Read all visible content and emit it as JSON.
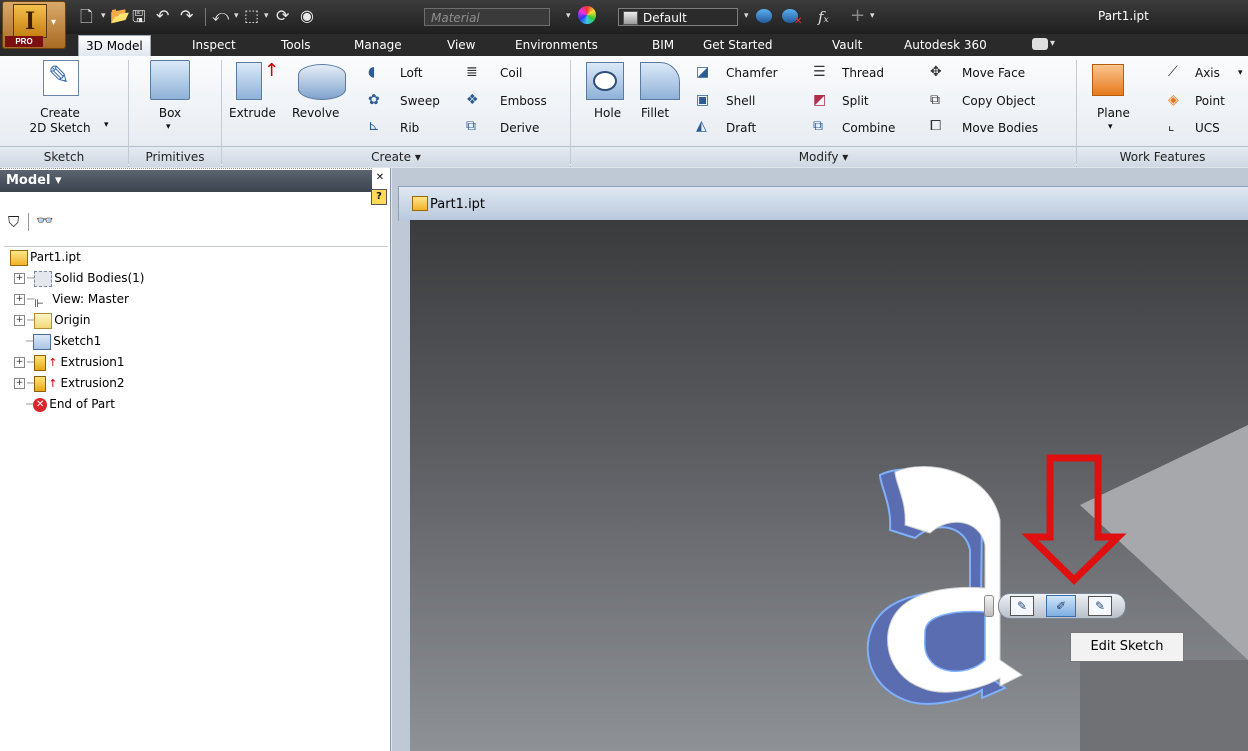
{
  "app": {
    "badge": "PRO",
    "window_title": "Part1.ipt"
  },
  "qat": {
    "material_placeholder": "Material",
    "appearance_value": "Default"
  },
  "tabs": [
    "3D Model",
    "Inspect",
    "Tools",
    "Manage",
    "View",
    "Environments",
    "BIM",
    "Get Started",
    "Vault",
    "Autodesk 360"
  ],
  "ribbon": {
    "sketch": {
      "create_line1": "Create",
      "create_line2": "2D Sketch",
      "panel": "Sketch"
    },
    "primitives": {
      "box": "Box",
      "panel": "Primitives"
    },
    "create": {
      "extrude": "Extrude",
      "revolve": "Revolve",
      "loft": "Loft",
      "sweep": "Sweep",
      "rib": "Rib",
      "coil": "Coil",
      "emboss": "Emboss",
      "derive": "Derive",
      "panel": "Create ▾"
    },
    "modify": {
      "hole": "Hole",
      "fillet": "Fillet",
      "chamfer": "Chamfer",
      "shell": "Shell",
      "draft": "Draft",
      "thread": "Thread",
      "split": "Split",
      "combine": "Combine",
      "move_face": "Move Face",
      "copy_object": "Copy Object",
      "move_bodies": "Move Bodies",
      "panel": "Modify ▾"
    },
    "work": {
      "plane": "Plane",
      "axis": "Axis",
      "point": "Point",
      "ucs": "UCS",
      "panel": "Work Features"
    }
  },
  "browser": {
    "title": "Model ▾",
    "tree": [
      {
        "label": "Part1.ipt"
      },
      {
        "label": "Solid Bodies(1)"
      },
      {
        "label": "View: Master"
      },
      {
        "label": "Origin"
      },
      {
        "label": "Sketch1"
      },
      {
        "label": "Extrusion1"
      },
      {
        "label": "Extrusion2"
      },
      {
        "label": "End of Part"
      }
    ]
  },
  "document": {
    "tab_label": "Part1.ipt"
  },
  "viewport": {
    "tooltip": "Edit Sketch"
  },
  "colors": {
    "arrow": "#e01010",
    "extrude_side": "#5367a8",
    "extrude_face": "#ffffff"
  }
}
